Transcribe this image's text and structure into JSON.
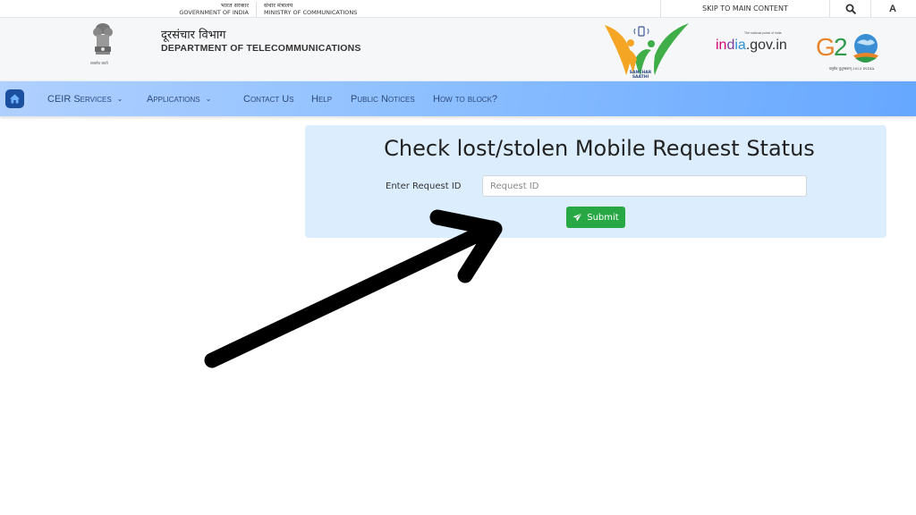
{
  "topbar": {
    "gov_hindi": "भारत सरकार",
    "gov_english": "GOVERNMENT OF INDIA",
    "ministry_hindi": "संचार मंत्रालय",
    "ministry_english": "MINISTRY OF COMMUNICATIONS",
    "skip_label": "SKIP TO MAIN CONTENT",
    "search_icon": "search-icon",
    "font_size_label": "A"
  },
  "header": {
    "emblem_caption": "सत्यमेव जयते",
    "dept_hindi": "दूरसंचार विभाग",
    "dept_english": "DEPARTMENT OF TELECOMMUNICATIONS",
    "sanchar_saathi": "SANCHAR SAATHI",
    "indiagov_tagline": "The national portal of India",
    "indiagov_logo": "india.gov.in",
    "g20_logo": "G20",
    "g20_caption": "वसुधैव कुटुम्बकम् 2023 INDIA"
  },
  "nav": {
    "home_icon": "home-icon",
    "items": [
      {
        "label": "CEIR Services",
        "has_dropdown": true
      },
      {
        "label": "Applications",
        "has_dropdown": true
      },
      {
        "label": "Contact Us",
        "has_dropdown": false
      },
      {
        "label": "Help",
        "has_dropdown": false
      },
      {
        "label": "Public Notices",
        "has_dropdown": false
      },
      {
        "label": "How to block?",
        "has_dropdown": false
      }
    ],
    "chevron": "⌄"
  },
  "form": {
    "title": "Check lost/stolen Mobile Request Status",
    "request_label": "Enter Request ID",
    "request_placeholder": "Request ID",
    "request_value": "",
    "submit_label": "Submit"
  },
  "colors": {
    "nav_start": "#b0d0ff",
    "nav_end": "#66a7ff",
    "card_bg": "#dcedfd",
    "submit_bg": "#28a745",
    "home_btn": "#1b4fa0"
  }
}
